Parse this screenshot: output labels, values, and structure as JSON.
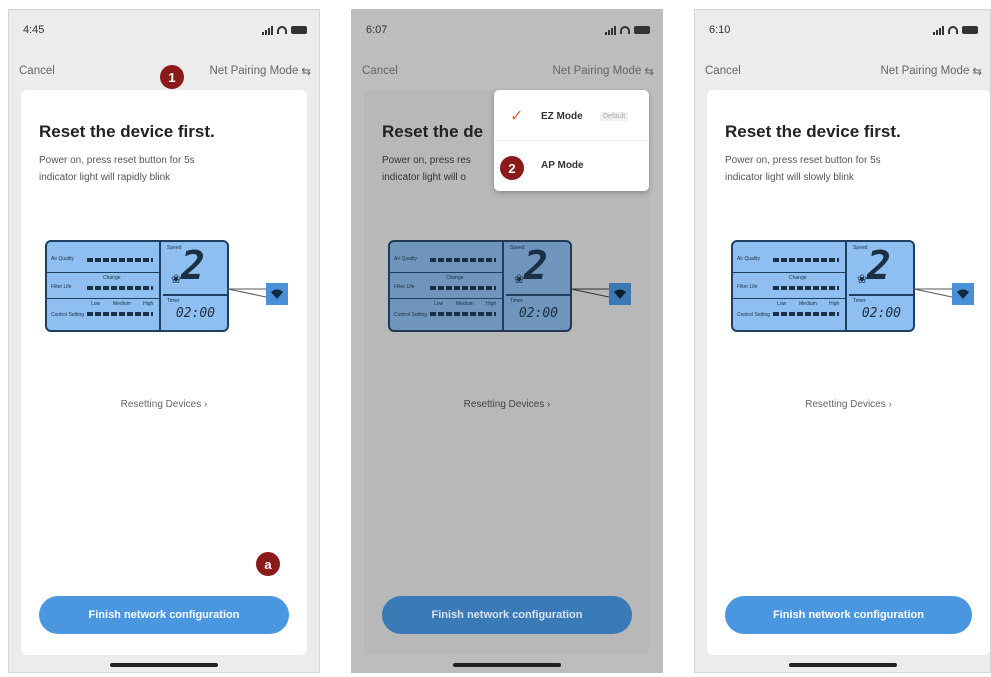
{
  "screens": [
    {
      "status_time": "4:45",
      "nav": {
        "cancel": "Cancel",
        "mode": "Net Pairing Mode",
        "mode_icon": "⇆"
      },
      "title": "Reset the device first.",
      "desc_line1": "Power on, press reset button for 5s",
      "desc_line2": "indicator light will rapidly blink",
      "reset_link": "Resetting Devices ›",
      "finish_button": "Finish network configuration"
    },
    {
      "status_time": "6:07",
      "nav": {
        "cancel": "Cancel",
        "mode": "Net Pairing Mode",
        "mode_icon": "⇆"
      },
      "title": "Reset the de",
      "desc_line1": "Power on, press res",
      "desc_line2": "indicator light will o",
      "reset_link": "Resetting Devices ›",
      "finish_button": "Finish network configuration"
    },
    {
      "status_time": "6:10",
      "nav": {
        "cancel": "Cancel",
        "mode": "Net Pairing Mode",
        "mode_icon": "⇆"
      },
      "title": "Reset the device first.",
      "desc_line1": "Power on, press reset button for 5s",
      "desc_line2": "indicator light will slowly blink",
      "reset_link": "Resetting Devices ›",
      "finish_button": "Finish network configuration"
    }
  ],
  "dropdown": {
    "ez_mode": "EZ Mode",
    "ez_default": "Default",
    "ap_mode": "AP Mode",
    "check_icon": "✓"
  },
  "lcd": {
    "row1_label": "Air Quality",
    "row2_label": "Filter Life",
    "row3_label": "Control Setting",
    "speed_label": "Speed",
    "timer_label": "Timer",
    "digit": "2",
    "timer": "02:00",
    "low": "Low",
    "medium": "Medium",
    "high": "High",
    "change": "Change"
  },
  "markers": {
    "step1": "1",
    "step2": "2",
    "step_a": "a"
  },
  "colors": {
    "accent_button": "#4a97e0",
    "marker": "#8b1a1a",
    "check": "#e06a3a",
    "lcd": "#8fbff0"
  }
}
